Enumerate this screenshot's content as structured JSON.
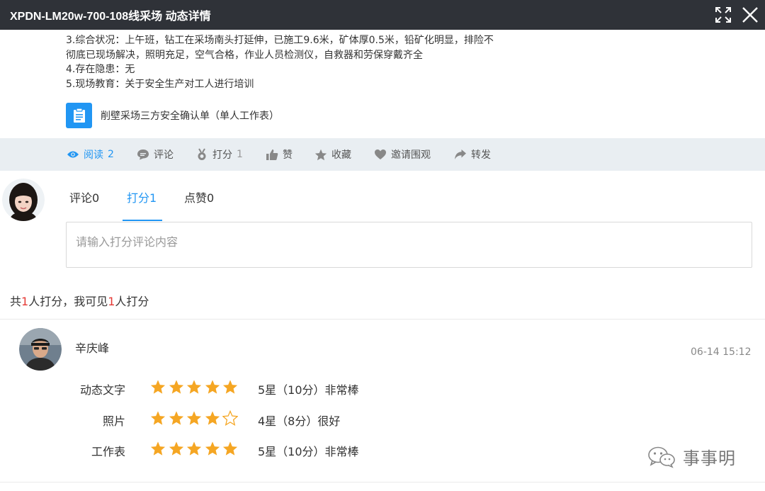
{
  "window": {
    "title": "XPDN-LM20w-700-108线采场 动态详情"
  },
  "post": {
    "lines": [
      "3.综合状况：上午班，钻工在采场南头打延伸，已施工9.6米，矿体厚0.5米，铅矿化明显，排险不",
      "彻底已现场解决，照明充足，空气合格，作业人员检测仪，自救器和劳保穿戴齐全",
      "4.存在隐患：无",
      "5.现场教育：关于安全生产对工人进行培训"
    ],
    "attachment": {
      "icon": "clipboard-icon",
      "name": "削壁采场三方安全确认单（单人工作表）"
    }
  },
  "actions": [
    {
      "icon": "eye-icon",
      "label": "阅读",
      "count": "2",
      "active": true
    },
    {
      "icon": "comment-icon",
      "label": "评论",
      "count": ""
    },
    {
      "icon": "medal-icon",
      "label": "打分",
      "count": "1"
    },
    {
      "icon": "thumbs-up-icon",
      "label": "赞",
      "count": ""
    },
    {
      "icon": "star-icon",
      "label": "收藏",
      "count": ""
    },
    {
      "icon": "heart-icon",
      "label": "邀请围观",
      "count": ""
    },
    {
      "icon": "share-icon",
      "label": "转发",
      "count": ""
    }
  ],
  "tabs": [
    {
      "label": "评论0"
    },
    {
      "label": "打分1",
      "active": true
    },
    {
      "label": "点赞0"
    }
  ],
  "comment_input": {
    "placeholder": "请输入打分评论内容"
  },
  "summary": {
    "prefix": "共",
    "total": "1",
    "middle": "人打分，我可见",
    "visible": "1",
    "suffix": "人打分"
  },
  "rating": {
    "rater": "辛庆峰",
    "time": "06-14 15:12",
    "items": [
      {
        "label": "动态文字",
        "stars": 5,
        "max": 5,
        "result": "5星（10分）非常棒"
      },
      {
        "label": "照片",
        "stars": 4,
        "max": 5,
        "result": "4星（8分）很好"
      },
      {
        "label": "工作表",
        "stars": 5,
        "max": 5,
        "result": "5星（10分）非常棒"
      }
    ]
  },
  "watermark": {
    "text": "事事明"
  },
  "colors": {
    "titlebar": "#2f3238",
    "accent": "#2196f3",
    "star": "#f5a623",
    "highlight": "#e53935",
    "actionbar": "#e9eef2"
  }
}
